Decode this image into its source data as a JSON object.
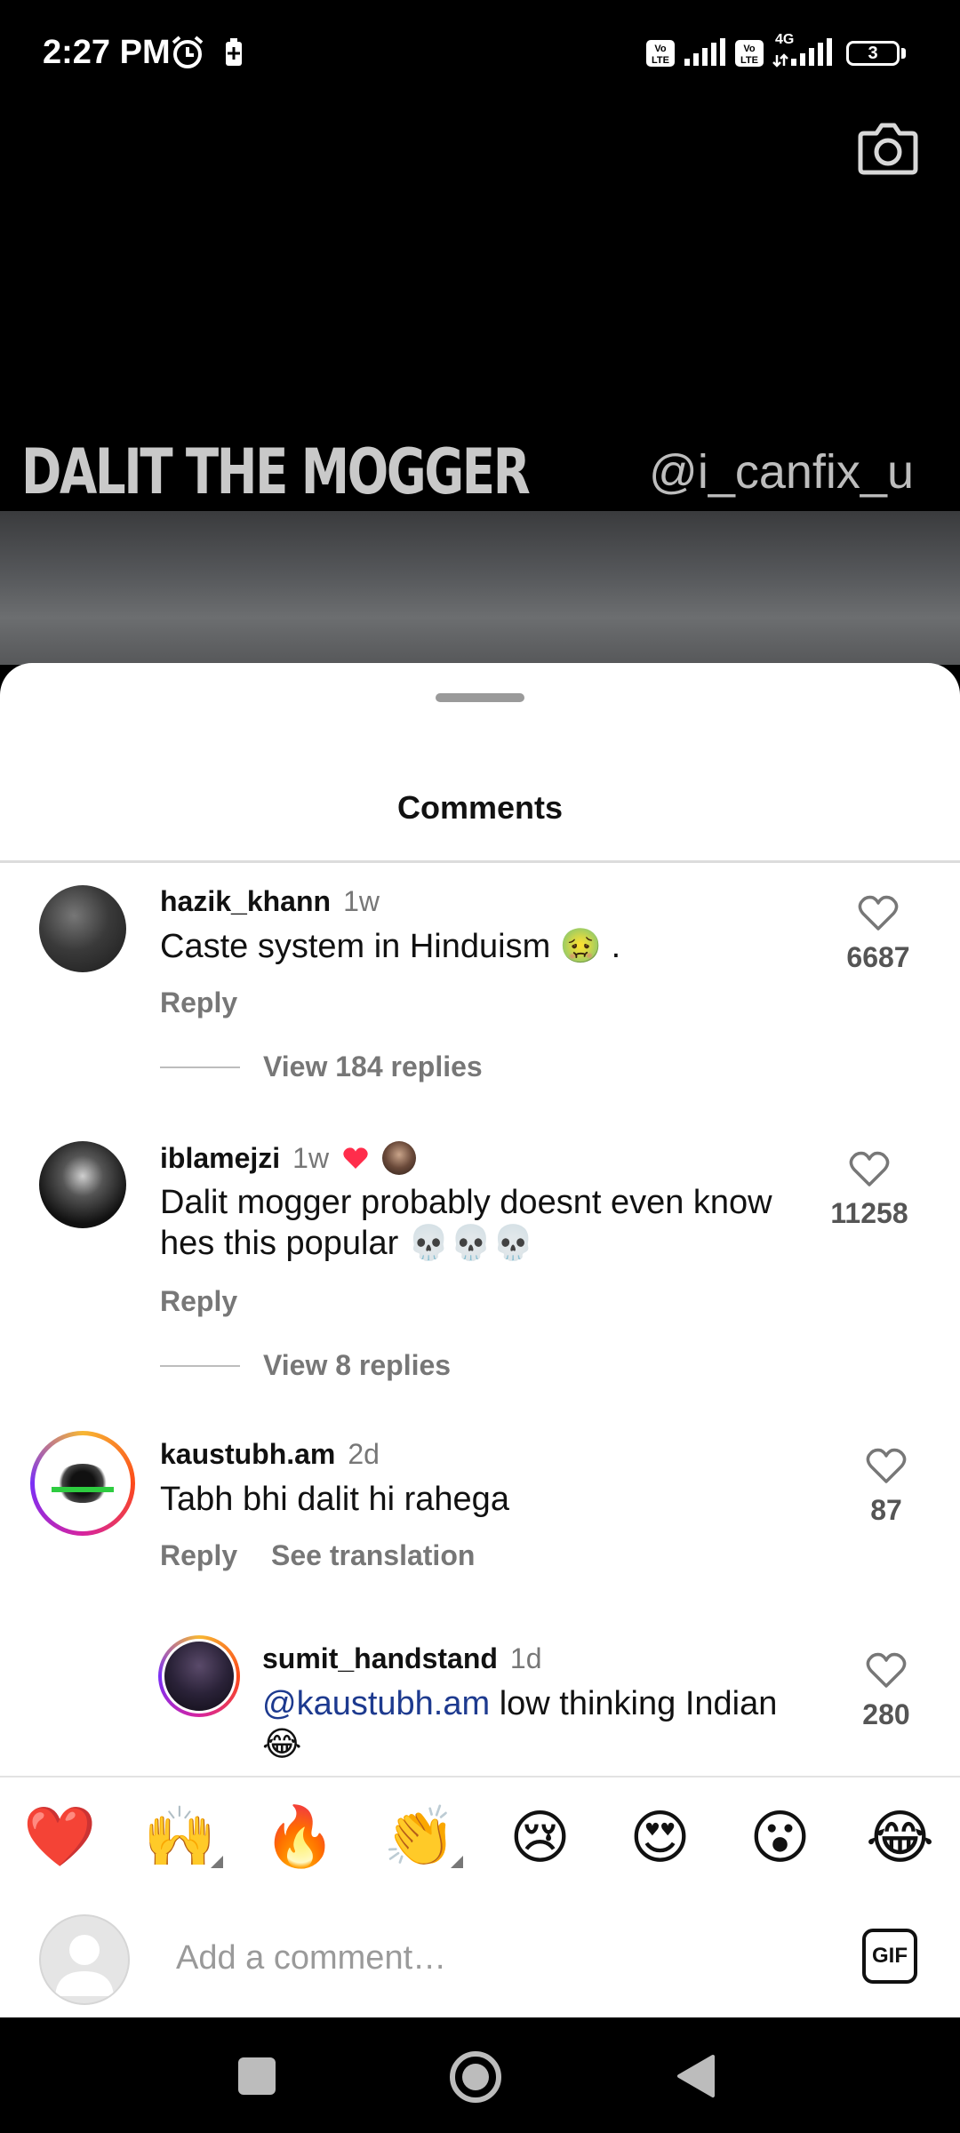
{
  "status_bar": {
    "time": "2:27 PM",
    "network": "4G",
    "battery": "3"
  },
  "video": {
    "caption_left": "DALIT THE MOGGER",
    "caption_right": "@i_canfix_u"
  },
  "sheet": {
    "title": "Comments"
  },
  "comments": [
    {
      "username": "hazik_khann",
      "time": "1w",
      "text": "Caste system in Hinduism 🤢 .",
      "reply": "Reply",
      "likes": "6687",
      "view_replies": "View 184 replies"
    },
    {
      "username": "iblamejzi",
      "time": "1w",
      "text_line1": "Dalit mogger probably doesnt even know",
      "text_line2": "hes this popular 💀💀💀",
      "reply": "Reply",
      "likes": "11258",
      "view_replies": "View 8 replies"
    },
    {
      "username": "kaustubh.am",
      "time": "2d",
      "text": "Tabh bhi dalit hi rahega",
      "reply": "Reply",
      "see_translation": "See translation",
      "likes": "87"
    },
    {
      "username": "sumit_handstand",
      "time": "1d",
      "mention": "@kaustubh.am",
      "text": " low thinking Indian",
      "text_line2": "😂",
      "likes": "280"
    }
  ],
  "emoji_bar": [
    "❤️",
    "🙌",
    "🔥",
    "👏",
    "😢",
    "😍",
    "😮",
    "😂"
  ],
  "input": {
    "placeholder": "Add a comment…",
    "gif_label": "GIF"
  },
  "colors": {
    "heart_red": "#ff2d4b",
    "mention_blue": "#1d3a8f"
  }
}
